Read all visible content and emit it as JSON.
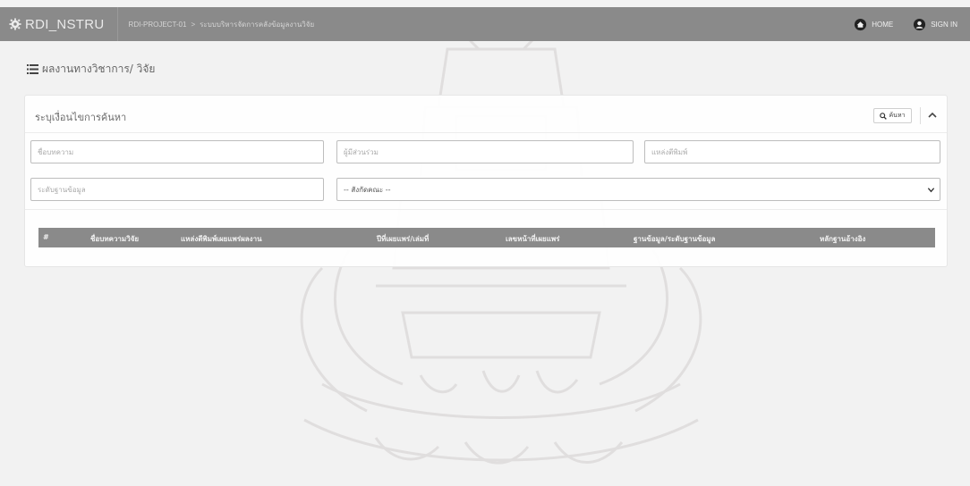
{
  "header": {
    "brand": "RDI_NSTRU",
    "breadcrumb": [
      "RDI-PROJECT-01",
      "ระบบบริหารจัดการคลังข้อมูลงานวิจัย"
    ],
    "home_label": "HOME",
    "signin_label": "SIGN IN"
  },
  "page": {
    "title": "ผลงานทางวิชาการ/ วิจัย"
  },
  "search_panel": {
    "title": "ระบุเงื่อนไขการค้นหา",
    "search_button": "ค้นหา",
    "fields": {
      "article_name_placeholder": "ชื่อบทความ",
      "co_author_placeholder": "ผู้มีส่วนร่วม",
      "publisher_placeholder": "แหล่งตีพิมพ์",
      "database_level_placeholder": "ระดับฐานข้อมูล"
    },
    "faculty_select": {
      "value": "-- สังกัดคณะ --"
    }
  },
  "table": {
    "columns": [
      "#",
      "ชื่อบทความวิจัย",
      "แหล่งตีพิมพ์เผยแพร่ผลงาน",
      "ปีที่เผยแพร่/เล่มที่",
      "เลขหน้าที่เผยแพร่",
      "ฐานข้อมูล/ระดับฐานข้อมูล",
      "หลักฐานอ้างอิง"
    ],
    "rows": []
  },
  "colors": {
    "topbar": "#8a8a8a",
    "table_header": "#8a8a8a",
    "background": "#f2f2f2"
  },
  "icons": [
    "gear-icon",
    "home-icon",
    "user-icon",
    "list-icon",
    "search-icon",
    "chevron-up-icon",
    "chevron-down-icon"
  ]
}
